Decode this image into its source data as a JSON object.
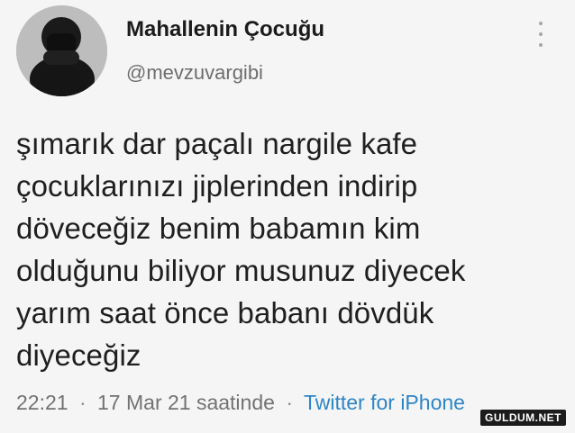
{
  "author": {
    "display_name": "Mahallenin Çocuğu",
    "handle": "@mevzuvargibi"
  },
  "tweet": {
    "lines": [
      "şımarık dar paçalı nargile kafe",
      "çocuklarınızı jiplerinden indirip",
      "döveceğiz benim babamın kim",
      "olduğunu biliyor musunuz diyecek",
      "yarım saat önce babanı dövdük",
      "diyeceğiz"
    ]
  },
  "meta": {
    "time": "22:21",
    "separator": "·",
    "date": "17 Mar 21 saatinde",
    "source": "Twitter for iPhone"
  },
  "watermark": {
    "text": "GULDUM.NET"
  },
  "icons": {
    "more": "more-vertical-icon",
    "avatar": "avatar-image"
  },
  "colors": {
    "background": "#f5f5f5",
    "text": "#1f1f1f",
    "muted": "#727272",
    "link": "#2d85c6"
  }
}
